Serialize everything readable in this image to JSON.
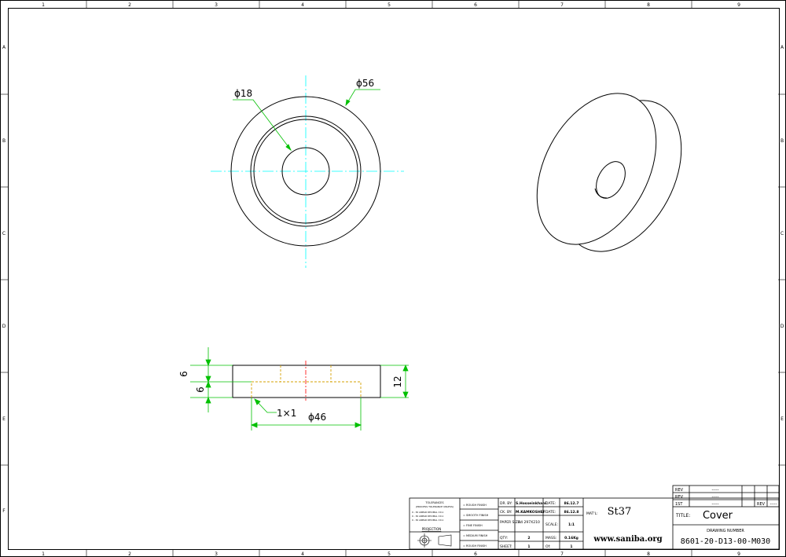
{
  "colors": {
    "line": "#000000",
    "center": "#00ffff",
    "dimension": "#00c000",
    "hidden": "#d4a000",
    "axis": "#ff0000"
  },
  "border": {
    "columns": [
      "1",
      "2",
      "3",
      "4",
      "5",
      "6",
      "7",
      "8",
      "9"
    ],
    "rows": [
      "A",
      "B",
      "C",
      "D",
      "E",
      "F"
    ]
  },
  "dimensions": {
    "bore": "ϕ18",
    "outer": "ϕ56",
    "step": "ϕ46",
    "chamfer": "1×1",
    "top_h": "6",
    "bot_h": "6",
    "total_h": "12"
  },
  "title_block": {
    "tol_title": "TOLERANCES",
    "tol_sub": "(PROCESS TOLERANCE UNLESS)",
    "tol_rows": [
      "0 - 30 LINEAR DECIMAL ±0.1",
      "0 - 30 LINEAR DECIMAL ±0.1",
      "0 - 30 LINEAR DECIMAL ±0.1"
    ],
    "projection_label": "PROJECTION",
    "finish_rows": [
      "= ROUGH FINISH",
      "= SMOOTH FINISH",
      "= FINE FINISH",
      "= MEDIUM FINISH",
      "= ROUGH FINISH"
    ],
    "labels": {
      "dr_by": "DR. BY:",
      "ck_by": "CK. BY:",
      "paper_size": "PAPER SIZE:",
      "qty": "QTY:",
      "sheet": "SHEET:",
      "date1": "DATE:",
      "date2": "DATE:",
      "scale": "SCALE:",
      "mass": "MASS:",
      "of": "Of:",
      "mat": "MAT'L:",
      "title": "TITLE:",
      "drawing_number": "DRAWING NUMBER"
    },
    "values": {
      "dr_by": "S.Hosseinkhani",
      "ck_by": "M.KAMKOSHEF",
      "paper_size": "A4 297X210",
      "qty": "2",
      "sheet": "1",
      "date1": "86.12.7",
      "date2": "86.12.8",
      "scale": "1:1",
      "mass": "0.16Kg",
      "of": "1",
      "material": "St37",
      "website": "www.saniba.org",
      "title": "Cover",
      "drawing_number": "8601-20-D13-00-M030"
    },
    "rev": {
      "label": "REV",
      "value": "-----",
      "row_labels": [
        "REV",
        "REV",
        "1ST"
      ],
      "row_values": [
        "-----",
        "-----",
        "-----"
      ]
    }
  }
}
